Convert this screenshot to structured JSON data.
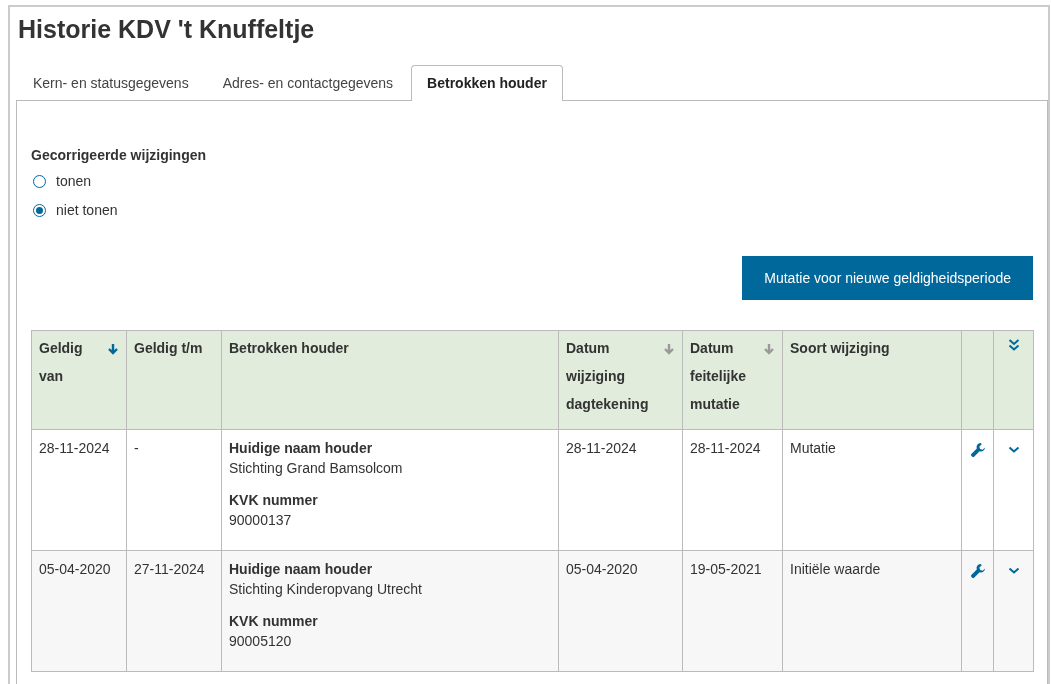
{
  "title": "Historie KDV 't Knuffeltje",
  "tabs": [
    {
      "label": "Kern- en statusgegevens",
      "selected": false
    },
    {
      "label": "Adres- en contactgegevens",
      "selected": false
    },
    {
      "label": "Betrokken houder",
      "selected": true
    }
  ],
  "filter": {
    "label": "Gecorrigeerde wijzigingen",
    "options": [
      {
        "label": "tonen",
        "selected": false
      },
      {
        "label": "niet tonen",
        "selected": true
      }
    ]
  },
  "action_button": "Mutatie voor nieuwe geldigheidsperiode",
  "table": {
    "columns": [
      {
        "label": "Geldig van",
        "sortable": true,
        "sorted": true
      },
      {
        "label": "Geldig t/m",
        "sortable": false
      },
      {
        "label": "Betrokken houder",
        "sortable": false
      },
      {
        "label": "Datum wijziging dagtekening",
        "sortable": true,
        "sorted": false
      },
      {
        "label": "Datum feitelijke mutatie",
        "sortable": true,
        "sorted": false
      },
      {
        "label": "Soort wijziging",
        "sortable": false
      }
    ],
    "rows": [
      {
        "valid_from": "28-11-2024",
        "valid_to": "-",
        "holder": [
          {
            "label": "Huidige naam houder",
            "value": "Stichting Grand Bamsolcom"
          },
          {
            "label": "KVK nummer",
            "value": "90000137"
          }
        ],
        "date_dated": "28-11-2024",
        "date_actual": "28-11-2024",
        "change_type": "Mutatie"
      },
      {
        "valid_from": "05-04-2020",
        "valid_to": "27-11-2024",
        "holder": [
          {
            "label": "Huidige naam houder",
            "value": "Stichting Kinderopvang Utrecht"
          },
          {
            "label": "KVK nummer",
            "value": "90005120"
          }
        ],
        "date_dated": "05-04-2020",
        "date_actual": "19-05-2021",
        "change_type": "Initiële waarde"
      }
    ]
  }
}
